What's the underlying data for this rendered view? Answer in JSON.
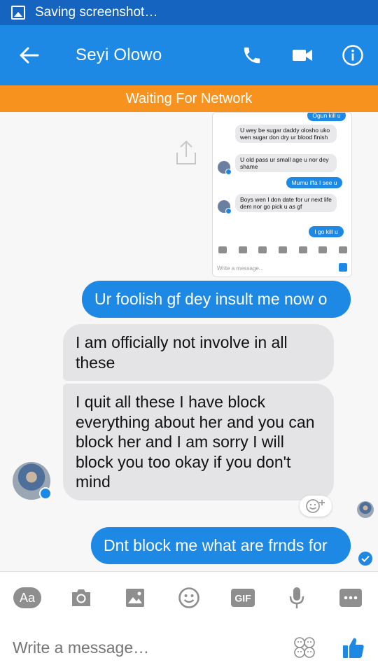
{
  "status_bar": {
    "text": "Saving screenshot…"
  },
  "header": {
    "title": "Seyi Olowo",
    "back_icon": "arrow-left-icon",
    "call_icon": "phone-icon",
    "video_icon": "video-camera-icon",
    "info_icon": "info-icon"
  },
  "banner": {
    "text": "Waiting For Network"
  },
  "embedded_screenshot": {
    "messages": [
      {
        "side": "out",
        "text": "Ogun kill u"
      },
      {
        "side": "in",
        "text": "U wey be sugar daddy olosho uko wen sugar don dry ur blood finish"
      },
      {
        "side": "in",
        "text": "U old pass ur small age u nor dey shame"
      },
      {
        "side": "out",
        "text": "Mumu iffa I see u"
      },
      {
        "side": "in",
        "text": "Boys wen I don date for ur next life dem nor go pick u as gf"
      },
      {
        "side": "out",
        "text": "I go kill u"
      }
    ],
    "compose_placeholder": "Write a message..."
  },
  "messages": [
    {
      "side": "out",
      "text": "Ur foolish gf dey insult me now o"
    },
    {
      "side": "in",
      "text": "I am officially not involve in all these"
    },
    {
      "side": "in",
      "text": "I quit all these I have block everything about her and you can block her and I am sorry I will block you too okay if you don't mind"
    },
    {
      "side": "out",
      "text": "Dnt block me what are frnds for"
    }
  ],
  "toolbar": {
    "items": [
      {
        "name": "text-style-icon",
        "label": "Aa"
      },
      {
        "name": "camera-icon"
      },
      {
        "name": "image-icon"
      },
      {
        "name": "emoji-icon"
      },
      {
        "name": "gif-icon",
        "label": "GIF"
      },
      {
        "name": "microphone-icon"
      },
      {
        "name": "more-icon"
      }
    ]
  },
  "composer": {
    "placeholder": "Write a message…",
    "like_icon": "thumbs-up-icon",
    "sticker_icon": "sticker-icon"
  },
  "colors": {
    "accent": "#1e88e5",
    "status_bar": "#1564c0",
    "banner": "#f7921e",
    "incoming_bubble": "#e4e4e6"
  }
}
